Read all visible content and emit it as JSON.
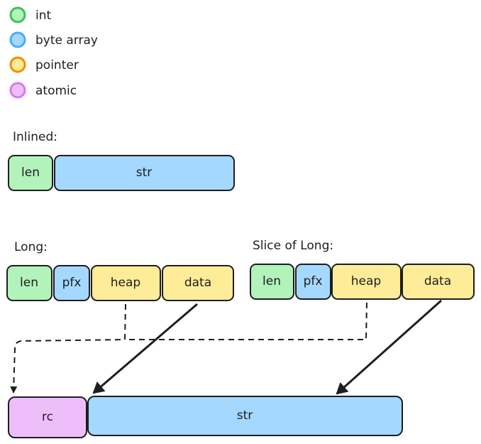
{
  "legend": [
    {
      "label": "int",
      "fill": "#b2f2bb",
      "stroke": "#40c057"
    },
    {
      "label": "byte array",
      "fill": "#a5d8ff",
      "stroke": "#4dabf7"
    },
    {
      "label": "pointer",
      "fill": "#ffec99",
      "stroke": "#f08c00"
    },
    {
      "label": "atomic",
      "fill": "#eebefa",
      "stroke": "#da77f2"
    }
  ],
  "inlined": {
    "title": "Inlined:",
    "fields": [
      "len",
      "str"
    ]
  },
  "long": {
    "title": "Long:",
    "fields": [
      "len",
      "pfx",
      "heap",
      "data"
    ]
  },
  "slice": {
    "title": "Slice of Long:",
    "fields": [
      "len",
      "pfx",
      "heap",
      "data"
    ]
  },
  "heap_buffer": {
    "fields": [
      "rc",
      "str"
    ]
  }
}
